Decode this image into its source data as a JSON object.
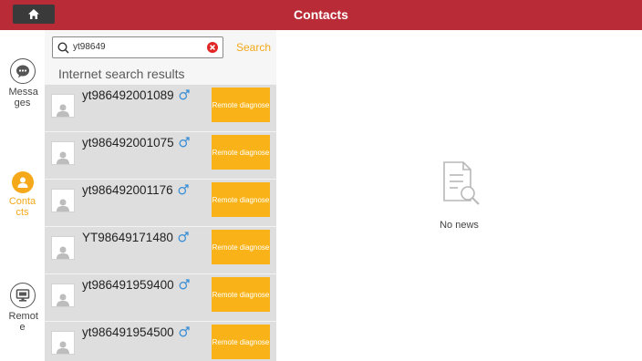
{
  "header": {
    "title": "Contacts",
    "home_icon": "home-icon"
  },
  "sidebar": {
    "items": [
      {
        "label": "Messa ges",
        "icon": "chat-bubble-icon",
        "active": false
      },
      {
        "label": "Conta cts",
        "icon": "person-icon",
        "active": true
      },
      {
        "label": "Remot e",
        "icon": "monitor-icon",
        "active": false
      }
    ]
  },
  "search": {
    "value": "yt98649",
    "button_label": "Search",
    "clear_icon": "clear-icon"
  },
  "results": {
    "heading": "Internet search results",
    "rows": [
      {
        "name": "yt986492001089",
        "action": "Remote diagnose"
      },
      {
        "name": "yt986492001075",
        "action": "Remote diagnose"
      },
      {
        "name": "yt986492001176",
        "action": "Remote diagnose"
      },
      {
        "name": "YT98649171480",
        "action": "Remote diagnose"
      },
      {
        "name": "yt986491959400",
        "action": "Remote diagnose"
      },
      {
        "name": "yt986491954500",
        "action": "Remote diagnose"
      }
    ]
  },
  "empty_state": {
    "text": "No news",
    "icon": "document-search-icon"
  },
  "colors": {
    "header": "#b92b36",
    "accent": "#f4a81a",
    "button": "#f9b319",
    "gender": "#3b8fd6"
  }
}
